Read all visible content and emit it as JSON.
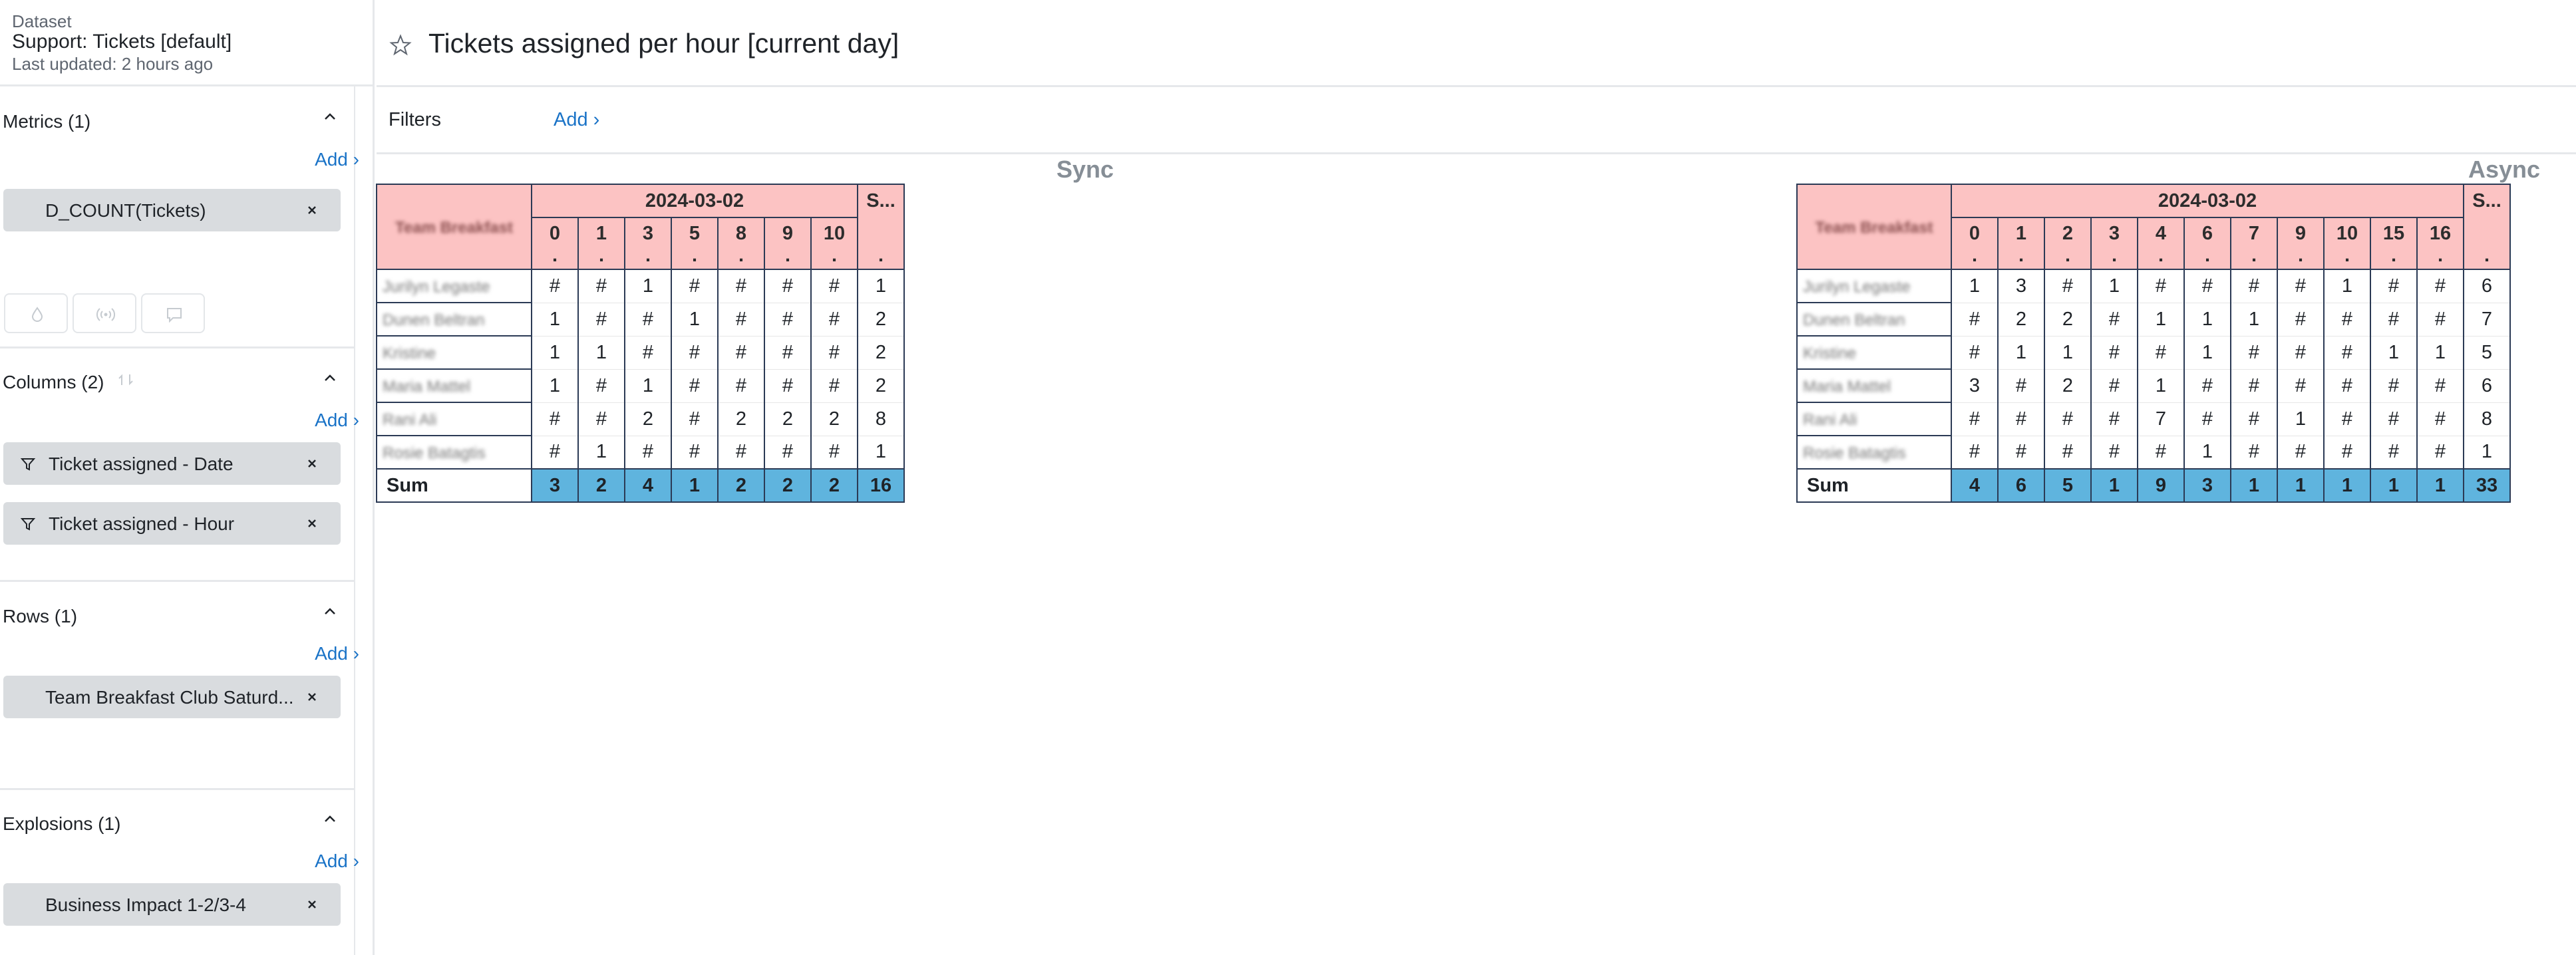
{
  "dataset": {
    "label": "Dataset",
    "name": "Support: Tickets [default]",
    "updated": "Last updated: 2 hours ago"
  },
  "sections": {
    "metrics": {
      "title": "Metrics (1)",
      "add": "Add ›",
      "items": [
        "D_COUNT(Tickets)"
      ]
    },
    "columns": {
      "title": "Columns (2)",
      "add": "Add ›",
      "items": [
        "Ticket assigned - Date",
        "Ticket assigned - Hour"
      ]
    },
    "rows": {
      "title": "Rows (1)",
      "add": "Add ›",
      "items": [
        "Team Breakfast Club Saturd..."
      ]
    },
    "explosions": {
      "title": "Explosions (1)",
      "add": "Add ›",
      "items": [
        "Business Impact 1-2/3-4"
      ]
    }
  },
  "page": {
    "title": "Tickets assigned per hour [current day]",
    "filters_label": "Filters",
    "filters_add": "Add ›"
  },
  "pivots": [
    {
      "title": "Sync",
      "row_header": "Team Breakfast",
      "date": "2024-03-02",
      "sum_header": "S...",
      "hours": [
        "0",
        "1",
        "3",
        "5",
        "8",
        "9",
        "10"
      ],
      "rows": [
        {
          "name": "Jurilyn Legaste",
          "values": [
            "#",
            "#",
            "1",
            "#",
            "#",
            "#",
            "#"
          ],
          "sum": "1"
        },
        {
          "name": "Dunen Beltran",
          "values": [
            "1",
            "#",
            "#",
            "1",
            "#",
            "#",
            "#"
          ],
          "sum": "2"
        },
        {
          "name": "Kristine",
          "values": [
            "1",
            "1",
            "#",
            "#",
            "#",
            "#",
            "#"
          ],
          "sum": "2"
        },
        {
          "name": "Maria Mattel",
          "values": [
            "1",
            "#",
            "1",
            "#",
            "#",
            "#",
            "#"
          ],
          "sum": "2"
        },
        {
          "name": "Rani Ali",
          "values": [
            "#",
            "#",
            "2",
            "#",
            "2",
            "2",
            "2"
          ],
          "sum": "8"
        },
        {
          "name": "Rosie Batagtis",
          "values": [
            "#",
            "1",
            "#",
            "#",
            "#",
            "#",
            "#"
          ],
          "sum": "1"
        }
      ],
      "sum_label": "Sum",
      "sums": [
        "3",
        "2",
        "4",
        "1",
        "2",
        "2",
        "2"
      ],
      "grand_total": "16"
    },
    {
      "title": "Async",
      "row_header": "Team Breakfast",
      "date": "2024-03-02",
      "sum_header": "S...",
      "hours": [
        "0",
        "1",
        "2",
        "3",
        "4",
        "6",
        "7",
        "9",
        "10",
        "15",
        "16"
      ],
      "rows": [
        {
          "name": "Jurilyn Legaste",
          "values": [
            "1",
            "3",
            "#",
            "1",
            "#",
            "#",
            "#",
            "#",
            "1",
            "#",
            "#"
          ],
          "sum": "6"
        },
        {
          "name": "Dunen Beltran",
          "values": [
            "#",
            "2",
            "2",
            "#",
            "1",
            "1",
            "1",
            "#",
            "#",
            "#",
            "#"
          ],
          "sum": "7"
        },
        {
          "name": "Kristine",
          "values": [
            "#",
            "1",
            "1",
            "#",
            "#",
            "1",
            "#",
            "#",
            "#",
            "1",
            "1"
          ],
          "sum": "5"
        },
        {
          "name": "Maria Mattel",
          "values": [
            "3",
            "#",
            "2",
            "#",
            "1",
            "#",
            "#",
            "#",
            "#",
            "#",
            "#"
          ],
          "sum": "6"
        },
        {
          "name": "Rani Ali",
          "values": [
            "#",
            "#",
            "#",
            "#",
            "7",
            "#",
            "#",
            "1",
            "#",
            "#",
            "#"
          ],
          "sum": "8"
        },
        {
          "name": "Rosie Batagtis",
          "values": [
            "#",
            "#",
            "#",
            "#",
            "#",
            "1",
            "#",
            "#",
            "#",
            "#",
            "#"
          ],
          "sum": "1"
        }
      ],
      "sum_label": "Sum",
      "sums": [
        "4",
        "6",
        "5",
        "1",
        "9",
        "3",
        "1",
        "1",
        "1",
        "1",
        "1"
      ],
      "grand_total": "33"
    }
  ]
}
